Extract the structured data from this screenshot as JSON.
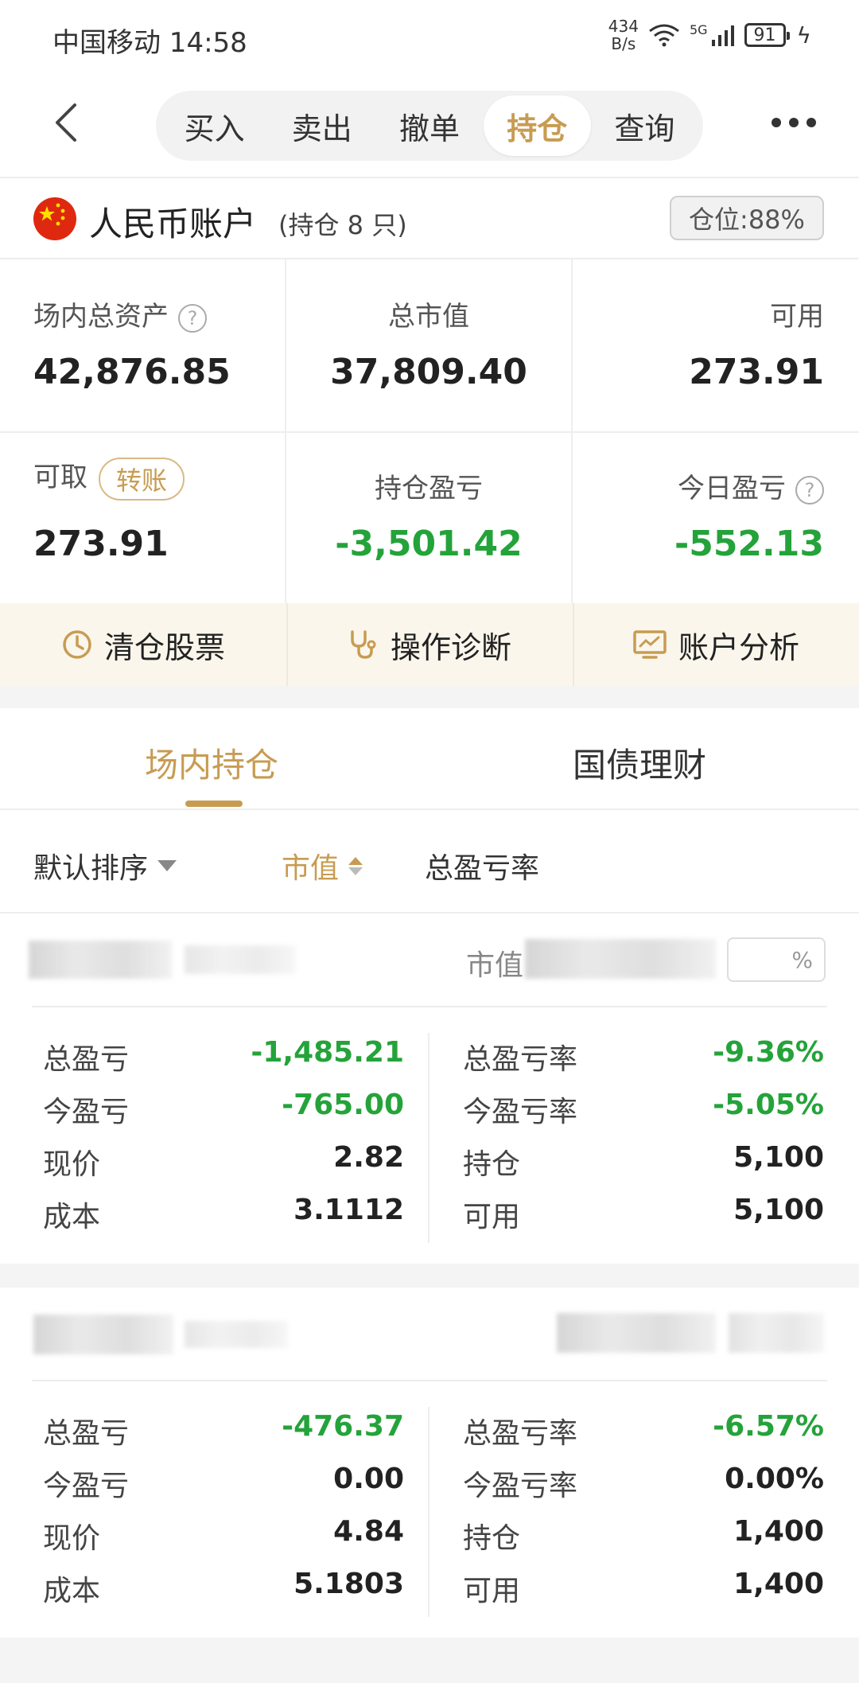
{
  "status_bar": {
    "carrier_time": "中国移动 14:58",
    "speed_value": "434",
    "speed_unit": "B/s",
    "network": "5G",
    "battery": "91",
    "icons": [
      "wifi-icon",
      "signal-icon",
      "battery-icon",
      "charging-icon"
    ]
  },
  "nav": {
    "tabs": [
      {
        "label": "买入",
        "active": false
      },
      {
        "label": "卖出",
        "active": false
      },
      {
        "label": "撤单",
        "active": false
      },
      {
        "label": "持仓",
        "active": true
      },
      {
        "label": "查询",
        "active": false
      }
    ]
  },
  "account": {
    "name": "人民币账户",
    "holdings_note": "(持仓 8 只)",
    "position_ratio": "仓位:88%"
  },
  "stats": {
    "total_assets": {
      "label": "场内总资产",
      "value": "42,876.85"
    },
    "market_value": {
      "label": "总市值",
      "value": "37,809.40"
    },
    "available": {
      "label": "可用",
      "value": "273.91"
    },
    "withdrawable": {
      "label": "可取",
      "value": "273.91",
      "transfer_label": "转账"
    },
    "position_pnl": {
      "label": "持仓盈亏",
      "value": "-3,501.42"
    },
    "today_pnl": {
      "label": "今日盈亏",
      "value": "-552.13"
    }
  },
  "actions": [
    {
      "label": "清仓股票",
      "icon": "clock-icon"
    },
    {
      "label": "操作诊断",
      "icon": "stethoscope-icon"
    },
    {
      "label": "账户分析",
      "icon": "monitor-chart-icon"
    }
  ],
  "content_tabs": [
    {
      "label": "场内持仓",
      "active": true
    },
    {
      "label": "国债理财",
      "active": false
    }
  ],
  "sort": {
    "default": "默认排序",
    "market_value": "市值",
    "total_rate": "总盈亏率"
  },
  "colors": {
    "accent": "#c79c52",
    "loss": "#24a33a",
    "action_bg": "#fbf6ec"
  },
  "holdings": [
    {
      "mv_label": "市值",
      "pct_box": "%",
      "rows_left": [
        {
          "k": "总盈亏",
          "v": "-1,485.21",
          "neg": true
        },
        {
          "k": "今盈亏",
          "v": "-765.00",
          "neg": true
        },
        {
          "k": "现价",
          "v": "2.82",
          "neg": false
        },
        {
          "k": "成本",
          "v": "3.1112",
          "neg": false
        }
      ],
      "rows_right": [
        {
          "k": "总盈亏率",
          "v": "-9.36%",
          "neg": true
        },
        {
          "k": "今盈亏率",
          "v": "-5.05%",
          "neg": true
        },
        {
          "k": "持仓",
          "v": "5,100",
          "neg": false
        },
        {
          "k": "可用",
          "v": "5,100",
          "neg": false
        }
      ]
    },
    {
      "mv_label": "",
      "pct_box": "",
      "rows_left": [
        {
          "k": "总盈亏",
          "v": "-476.37",
          "neg": true
        },
        {
          "k": "今盈亏",
          "v": "0.00",
          "neg": false
        },
        {
          "k": "现价",
          "v": "4.84",
          "neg": false
        },
        {
          "k": "成本",
          "v": "5.1803",
          "neg": false
        }
      ],
      "rows_right": [
        {
          "k": "总盈亏率",
          "v": "-6.57%",
          "neg": true
        },
        {
          "k": "今盈亏率",
          "v": "0.00%",
          "neg": false
        },
        {
          "k": "持仓",
          "v": "1,400",
          "neg": false
        },
        {
          "k": "可用",
          "v": "1,400",
          "neg": false
        }
      ]
    }
  ]
}
